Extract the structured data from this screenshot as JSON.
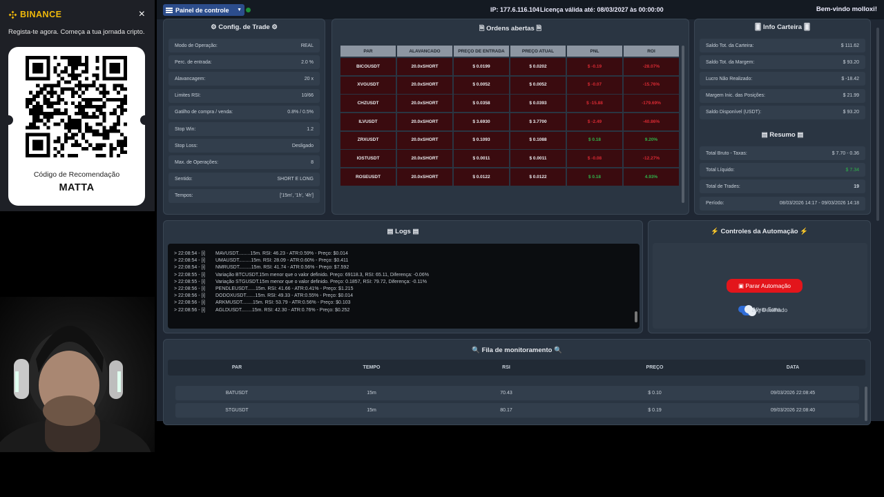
{
  "binance": {
    "brand": "BINANCE",
    "tagline": "Regista-te agora. Começa a tua jornada cripto.",
    "ref_title": "Código de Recomendação",
    "ref_code": "MATTA",
    "close": "×"
  },
  "topbar": {
    "panel_label": "Painel de controle",
    "ip": "IP: 177.6.116.104",
    "license": "Licença válida até: 08/03/2027 às 00:00:00",
    "welcome": "Bem-vindo molloxi!"
  },
  "config": {
    "title": "Config. de Trade",
    "rows": [
      {
        "label": "Modo de Operação:",
        "value": "REAL"
      },
      {
        "label": "Perc. de entrada:",
        "value": "2.0 %"
      },
      {
        "label": "Alavancagem:",
        "value": "20 x"
      },
      {
        "label": "Limites RSI:",
        "value": "10/66"
      },
      {
        "label": "Gatilho de compra / venda:",
        "value": "0.8% / 0.5%"
      },
      {
        "label": "Stop Win:",
        "value": "1.2"
      },
      {
        "label": "Stop Loss:",
        "value": "Desligado"
      },
      {
        "label": "Max. de Operações:",
        "value": "8"
      },
      {
        "label": "Sentido:",
        "value": "SHORT E LONG"
      },
      {
        "label": "Tempos:",
        "value": "['15m', '1h', '4h']"
      }
    ]
  },
  "orders": {
    "title": "Ordens abertas",
    "headers": [
      "PAR",
      "ALAVANCADO",
      "PREÇO DE ENTRADA",
      "PREÇO ATUAL",
      "PNL",
      "ROI"
    ],
    "rows": [
      {
        "par": "BICOUSDT",
        "lev1": "20.0x",
        "lev2": "SHORT",
        "entry": "$ 0.0199",
        "current": "$ 0.0202",
        "pnl": "$ -0.19",
        "roi": "-28.07%",
        "sign": "neg"
      },
      {
        "par": "XVGUSDT",
        "lev1": "20.0x",
        "lev2": "SHORT",
        "entry": "$ 0.0052",
        "current": "$ 0.0052",
        "pnl": "$ -0.07",
        "roi": "-15.76%",
        "sign": "neg"
      },
      {
        "par": "CHZUSDT",
        "lev1": "20.0x",
        "lev2": "SHORT",
        "entry": "$ 0.0358",
        "current": "$ 0.0393",
        "pnl": "$ -15.88",
        "roi": "-179.69%",
        "sign": "neg"
      },
      {
        "par": "ILVUSDT",
        "lev1": "20.0x",
        "lev2": "SHORT",
        "entry": "$ 3.6930",
        "current": "$ 3.7700",
        "pnl": "$ -2.49",
        "roi": "-40.86%",
        "sign": "neg"
      },
      {
        "par": "ZRXUSDT",
        "lev1": "20.0x",
        "lev2": "SHORT",
        "entry": "$ 0.1093",
        "current": "$ 0.1088",
        "pnl": "$ 0.18",
        "roi": "9.20%",
        "sign": "pos"
      },
      {
        "par": "IOSTUSDT",
        "lev1": "20.0x",
        "lev2": "SHORT",
        "entry": "$ 0.0011",
        "current": "$ 0.0011",
        "pnl": "$ -0.08",
        "roi": "-12.27%",
        "sign": "neg"
      },
      {
        "par": "ROSEUSDT",
        "lev1": "20.0x",
        "lev2": "SHORT",
        "entry": "$ 0.0122",
        "current": "$ 0.0122",
        "pnl": "$ 0.18",
        "roi": "4.93%",
        "sign": "pos"
      }
    ]
  },
  "wallet": {
    "title": "Info Carteira",
    "rows": [
      {
        "label": "Saldo Tot. da Carteira:",
        "value": "$ 111.62"
      },
      {
        "label": "Saldo Tot. da Margem:",
        "value": "$ 93.20"
      },
      {
        "label": "Lucro Não Realizado:",
        "value": "$ -18.42"
      },
      {
        "label": "Margem Inic. das Posições:",
        "value": "$ 21.99"
      },
      {
        "label": "Saldo Disponível (USDT):",
        "value": "$ 93.20"
      }
    ]
  },
  "summary": {
    "title": "Resumo",
    "rows": [
      {
        "label": "Total Bruto - Taxas:",
        "value": "$ 7.70 - 0.36"
      },
      {
        "label": "Total Líquido:",
        "value": "$ 7.34"
      },
      {
        "label": "Total de Trades:",
        "value": "19"
      },
      {
        "label": "Período:",
        "value": "08/03/2026 14:17 - 09/03/2026 14:18"
      }
    ]
  },
  "logs": {
    "title": "Logs",
    "lines": [
      {
        "time": "> 22:08:54 - [i]",
        "msg": "MAVUSDT.........15m. RSI: 46.23 - ATR:0.59% - Preço: $0.014"
      },
      {
        "time": "> 22:08:54 - [i]",
        "msg": "UMAUSDT.........15m. RSI: 28.09 - ATR:0.60% - Preço: $0.411"
      },
      {
        "time": "> 22:08:54 - [i]",
        "msg": "NMRUSDT.........15m. RSI: 41.74 - ATR:0.56% - Preço: $7.592"
      },
      {
        "time": "> 22:08:55 - [i]",
        "msg": "Variação BTCUSDT.15m menor que o valor definido. Preço: 69118.3, RSI: 65.11, Diferença: -0.06%"
      },
      {
        "time": "> 22:08:55 - [i]",
        "msg": "Variação STGUSDT.15m menor que o valor definido. Preço: 0.1857, RSI: 79.72, Diferença: -0.11%"
      },
      {
        "time": "> 22:08:56 - [i]",
        "msg": "PENDLEUSDT......15m. RSI: 41.66 - ATR:0.41% - Preço: $1.215"
      },
      {
        "time": "> 22:08:56 - [i]",
        "msg": "DODOXUSDT.......15m. RSI: 49.33 - ATR:0.55% - Preço: $0.014"
      },
      {
        "time": "> 22:08:56 - [i]",
        "msg": "ARKMUSDT........15m. RSI: 53.79 - ATR:0.56% - Preço: $0.103"
      },
      {
        "time": "> 22:08:56 - [i]",
        "msg": "AGLDUSDT........15m. RSI: 42.30 - ATR:0.76% - Preço: $0.252"
      }
    ]
  },
  "controls": {
    "title": "Controles da Automação",
    "stop_label": "Parar Automação",
    "toggle1": "Log Detalhado",
    "toggle2": "Ativar Sons"
  },
  "queue": {
    "title": "Fila de monitoramento",
    "headers": [
      "PAR",
      "TEMPO",
      "RSI",
      "PREÇO",
      "DATA"
    ],
    "rows": [
      [
        "BATUSDT",
        "15m",
        "70.43",
        "$ 0.10",
        "09/03/2026 22:08:45"
      ],
      [
        "STGUSDT",
        "15m",
        "80.17",
        "$ 0.19",
        "09/03/2026 22:08:40"
      ]
    ]
  },
  "colors": {
    "accent": "#2c4d8c",
    "negative": "#d82a33",
    "positive": "#2fb24a",
    "danger_button": "#e3151b",
    "binance_yellow": "#f0b90b"
  }
}
